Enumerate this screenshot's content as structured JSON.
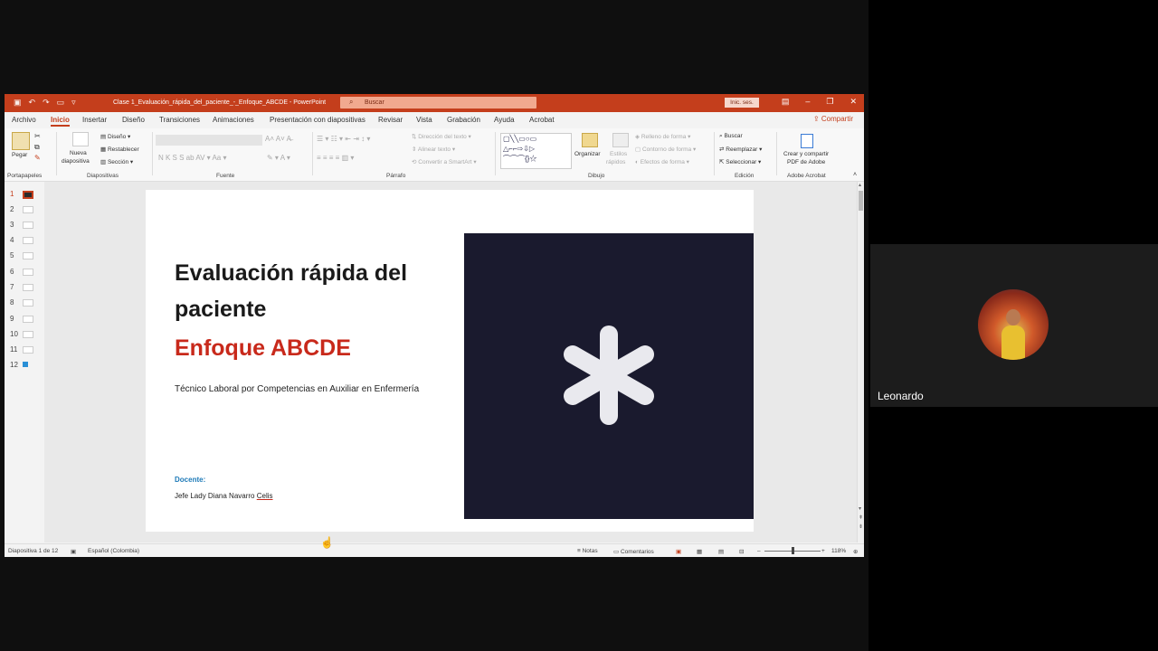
{
  "window": {
    "title": "Clase 1_Evaluación_rápida_del_paciente_-_Enfoque_ABCDE - PowerPoint",
    "search_placeholder": "Buscar",
    "signin": "Inic. ses."
  },
  "tabs": [
    "Archivo",
    "Inicio",
    "Insertar",
    "Diseño",
    "Transiciones",
    "Animaciones",
    "Presentación con diapositivas",
    "Revisar",
    "Vista",
    "Grabación",
    "Ayuda",
    "Acrobat"
  ],
  "active_tab": "Inicio",
  "share_label": "Compartir",
  "ribbon": {
    "groups": {
      "portapapeles": "Portapapeles",
      "diapositivas": "Diapositivas",
      "fuente": "Fuente",
      "parrafo": "Párrafo",
      "dibujo": "Dibujo",
      "edicion": "Edición",
      "acrobat": "Adobe Acrobat"
    },
    "paste": "Pegar",
    "new_slide_1": "Nueva",
    "new_slide_2": "diapositiva",
    "layout": "Diseño",
    "reset": "Restablecer",
    "section": "Sección",
    "text_direction": "Dirección del texto",
    "align_text": "Alinear texto",
    "convert_smartart": "Convertir a SmartArt",
    "arrange": "Organizar",
    "quick_styles_1": "Estilos",
    "quick_styles_2": "rápidos",
    "shape_fill": "Relleno de forma",
    "shape_outline": "Contorno de forma",
    "shape_effects": "Efectos de forma",
    "find": "Buscar",
    "replace": "Reemplazar",
    "select": "Seleccionar",
    "create_pdf_1": "Crear y compartir",
    "create_pdf_2": "PDF de Adobe"
  },
  "slides": [
    "1",
    "2",
    "3",
    "4",
    "5",
    "6",
    "7",
    "8",
    "9",
    "10",
    "11",
    "12"
  ],
  "current_slide": {
    "title": "Evaluación rápida del paciente",
    "subtitle": "Enfoque ABCDE",
    "description": "Técnico Laboral por Competencias en Auxiliar en Enfermería",
    "docente_label": "Docente:",
    "teacher_name": "Jefe Lady Diana Navarro",
    "teacher_surname": "Celis"
  },
  "status": {
    "slide_counter": "Diapositiva 1 de 12",
    "language": "Español (Colombia)",
    "notes": "Notas",
    "comments": "Comentarios",
    "zoom": "118%"
  },
  "participant": {
    "name": "Leonardo"
  },
  "colors": {
    "accent": "#c43e1c",
    "subtitle": "#c8291b",
    "docente": "#1e7ab8",
    "image_bg": "#1a1a2e"
  }
}
